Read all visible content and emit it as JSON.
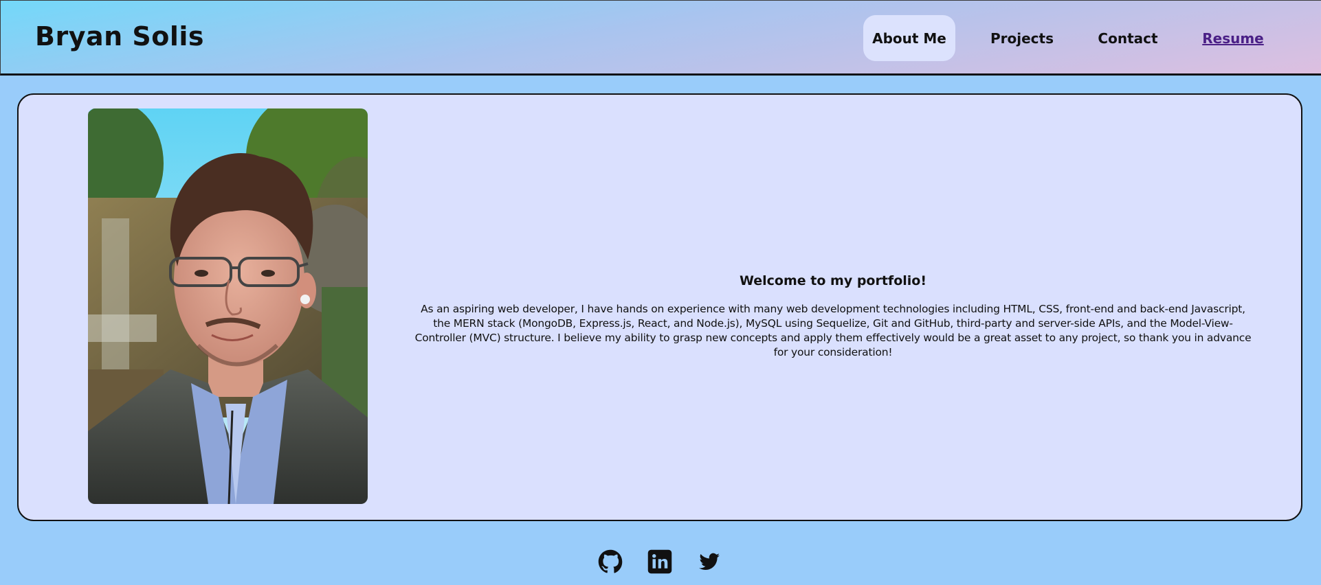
{
  "header": {
    "title": "Bryan Solis",
    "nav": [
      {
        "label": "About Me",
        "active": true
      },
      {
        "label": "Projects",
        "active": false
      },
      {
        "label": "Contact",
        "active": false
      },
      {
        "label": "Resume",
        "active": false,
        "style": "link"
      }
    ]
  },
  "main": {
    "photo": {
      "subject": "selfie portrait outdoors by a waterfall"
    },
    "welcome": "Welcome to my portfolio!",
    "bio": "As an aspiring web developer, I have hands on experience with many web development technologies including HTML, CSS, front-end and back-end Javascript, the MERN stack (MongoDB, Express.js, React, and Node.js), MySQL using Sequelize, Git and GitHub, third-party and server-side APIs, and the Model-View-Controller (MVC) structure. I believe my ability to grasp new concepts and apply them effectively would be a great asset to any project, so thank you in advance for your consideration!"
  },
  "footer": {
    "icons": [
      "github-icon",
      "linkedin-icon",
      "twitter-icon"
    ]
  },
  "colors": {
    "page_background": "#99ccfa",
    "card_background": "#dae0fe",
    "active_nav_background": "#dce2fd",
    "resume_link": "#4a1f86",
    "header_gradient_start": "#73d8f9",
    "header_gradient_end": "#ddbfe0"
  }
}
